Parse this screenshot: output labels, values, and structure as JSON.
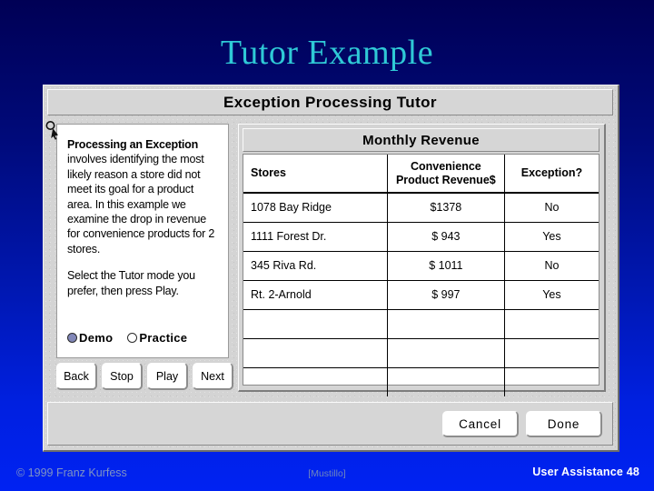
{
  "slide": {
    "title": "Tutor Example"
  },
  "window": {
    "title": "Exception Processing Tutor",
    "cursor_icon": "arrow-magnifier-cursor"
  },
  "instructions": {
    "heading": "Processing an Exception",
    "paragraph1_rest": " involves identifying the most likely reason a store did not meet its goal for a product area.  In this example we examine the drop in revenue for convenience products for 2 stores.",
    "paragraph2": "Select the Tutor mode you prefer, then press Play."
  },
  "mode": {
    "options": [
      {
        "label": "Demo",
        "selected": true
      },
      {
        "label": "Practice",
        "selected": false
      }
    ],
    "demo_label": "Demo",
    "practice_label": "Practice"
  },
  "transport": {
    "back_label": "Back",
    "stop_label": "Stop",
    "play_label": "Play",
    "next_label": "Next"
  },
  "revenue_panel": {
    "caption": "Monthly Revenue",
    "columns": {
      "store": "Stores",
      "revenue_line1": "Convenience",
      "revenue_line2": "Product Revenue$",
      "exception": "Exception?"
    },
    "rows": [
      {
        "store": "1078 Bay Ridge",
        "revenue": "$1378",
        "exception": "No"
      },
      {
        "store": "1111 Forest Dr.",
        "revenue": "$ 943",
        "exception": "Yes"
      },
      {
        "store": "345 Riva Rd.",
        "revenue": "$ 1011",
        "exception": "No"
      },
      {
        "store": "Rt. 2-Arnold",
        "revenue": "$  997",
        "exception": "Yes"
      },
      {
        "store": "",
        "revenue": "",
        "exception": ""
      },
      {
        "store": "",
        "revenue": "",
        "exception": ""
      },
      {
        "store": "",
        "revenue": "",
        "exception": ""
      }
    ]
  },
  "dialog_buttons": {
    "cancel_label": "Cancel",
    "done_label": "Done"
  },
  "footer": {
    "copyright": "© 1999 Franz Kurfess",
    "center": "[Mustillo]",
    "right": "User Assistance 48"
  },
  "colors": {
    "background_top": "#000055",
    "background_bottom": "#0022f2",
    "title_text": "#2fc9d6",
    "window_chrome": "#d4d4d4",
    "radio_selected": "#8187b8",
    "footer_left_text": "#7e93c4",
    "footer_right_text": "#ffffff"
  }
}
